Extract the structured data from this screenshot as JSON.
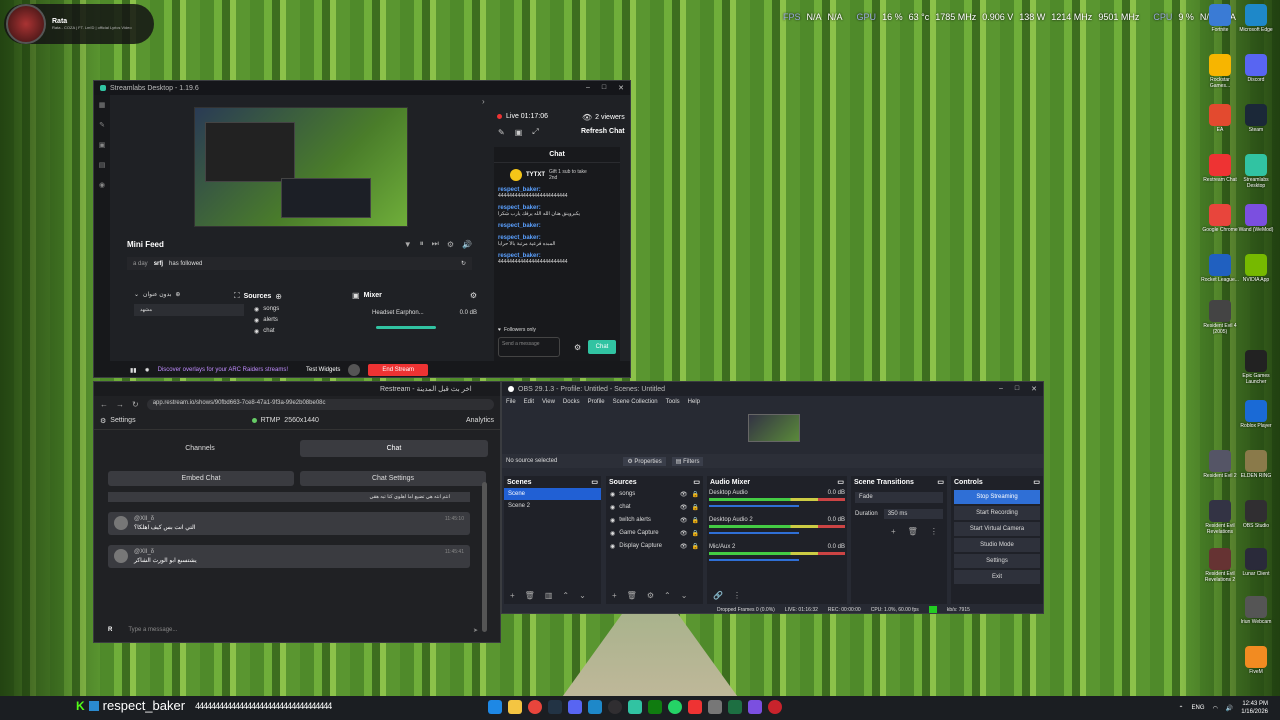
{
  "music": {
    "title": "Rata",
    "subtitle": "Rata - COZA | FT. Lm!D | official Lyrics Video"
  },
  "hud": {
    "fps_label": "FPS",
    "fps1": "N/A",
    "fps2": "N/A",
    "gpu_label": "GPU",
    "gpu_pct": "16 %",
    "gpu_temp": "63 °c",
    "gpu_clock": "1785 MHz",
    "gpu_volt": "0.906 V",
    "gpu_power": "138 W",
    "gpu_mem": "1214 MHz",
    "gpu_vram": "9501 MHz",
    "cpu_label": "CPU",
    "cpu_pct": "9 %",
    "cpu_na": "N/A",
    "cpu_na2": "N/A"
  },
  "desktop_icons": [
    {
      "label": "Fortnite",
      "color": "#3a7bd5"
    },
    {
      "label": "Microsoft Edge",
      "color": "#1e88c9"
    },
    {
      "label": "Rockstar Games...",
      "color": "#f7b500"
    },
    {
      "label": "Discord",
      "color": "#5865f2"
    },
    {
      "label": "EA",
      "color": "#e34a2f"
    },
    {
      "label": "Steam",
      "color": "#1b2838"
    },
    {
      "label": "Restream Chat",
      "color": "#e33"
    },
    {
      "label": "Streamlabs Desktop",
      "color": "#31c3a2"
    },
    {
      "label": "Google Chrome",
      "color": "#e8453c"
    },
    {
      "label": "Wand (WeMod)",
      "color": "#7b4fe0"
    },
    {
      "label": "Rocket League...",
      "color": "#2060c0"
    },
    {
      "label": "NVIDIA App",
      "color": "#76b900"
    },
    {
      "label": "Resident Evil 4 (2005)",
      "color": "#444"
    },
    {
      "label": "Epic Games Launcher",
      "color": "#222"
    },
    {
      "label": "Roblox Player",
      "color": "#1a6ad6"
    },
    {
      "label": "Resident Evil 2",
      "color": "#556"
    },
    {
      "label": "ELDEN RING",
      "color": "#8a7a4a"
    },
    {
      "label": "Resident Evil Revelations",
      "color": "#334"
    },
    {
      "label": "OBS Studio",
      "color": "#302e31"
    },
    {
      "label": "Resident Evil Revelations 2",
      "color": "#633"
    },
    {
      "label": "Lunar Client",
      "color": "#2a2a3a"
    },
    {
      "label": "Iriun Webcam",
      "color": "#555"
    },
    {
      "label": "FiveM",
      "color": "#f28b21"
    }
  ],
  "streamlabs": {
    "title": "Streamlabs Desktop - 1.19.6",
    "live": "Live 01:17:06",
    "viewers": "2 viewers",
    "refresh_chat": "Refresh Chat",
    "chat_title": "Chat",
    "gift_user": "TYTXT",
    "gift_text": "Gift 1 sub to take 2nd",
    "messages": [
      {
        "user": "respect_baker:",
        "text": "4444444444444444444444444"
      },
      {
        "user": "respect_baker:",
        "text": "يكبروينق هنان الله الله يرفك يارب شكرا"
      },
      {
        "user": "respect_baker:",
        "text": ""
      },
      {
        "user": "respect_baker:",
        "text": "المبده فرعية مرتبة بالأ حرابا"
      },
      {
        "user": "respect_baker:",
        "text": "4444444444444444444444444"
      }
    ],
    "followers_only": "Followers only",
    "send_placeholder": "Send a message",
    "chat_btn": "Chat",
    "mini_feed": "Mini Feed",
    "feed_time": "a day",
    "feed_user": "srfj",
    "feed_action": "has followed",
    "scenes_label": "بدون عنوان",
    "scene_item": "مشهد",
    "sources_label": "Sources",
    "sources": [
      "songs",
      "alerts",
      "chat"
    ],
    "mixer_label": "Mixer",
    "mixer_device": "Headset Earphon...",
    "mixer_db": "0.0 dB",
    "discover": "Discover overlays for your ARC Raiders streams!",
    "test_widgets": "Test Widgets",
    "end_stream": "End Stream"
  },
  "restream": {
    "tab_title": "Restream - اخر بث قبل المدينة",
    "url": "app.restream.io/shows/90fbd663-7ce8-47a1-9f3a-99e2b08be08c",
    "settings": "Settings",
    "rtmp": "RTMP",
    "resolution": "2560x1440",
    "analytics": "Analytics",
    "channels_tab": "Channels",
    "chat_tab": "Chat",
    "embed_chat": "Embed Chat",
    "chat_settings": "Chat Settings",
    "top_msg": "انتم انته هي تضيع اما اهلوي كنا تبه هقي",
    "messages": [
      {
        "user": "@XII_δ",
        "time": "11:45:10",
        "text": "التي انت بس كيف اهلكا؟"
      },
      {
        "user": "@XII_δ",
        "time": "11:45:41",
        "text": "يشتسبع ابو الورث الشاكر"
      }
    ],
    "type_placeholder": "Type a message..."
  },
  "obs": {
    "title": "OBS 29.1.3 - Profile: Untitled - Scenes: Untitled",
    "menu": [
      "File",
      "Edit",
      "View",
      "Docks",
      "Profile",
      "Scene Collection",
      "Tools",
      "Help"
    ],
    "no_source": "No source selected",
    "properties": "Properties",
    "filters": "Filters",
    "scenes_title": "Scenes",
    "scenes": [
      "Scene",
      "Scene 2"
    ],
    "sources_title": "Sources",
    "sources": [
      "songs",
      "chat",
      "twitch alerts",
      "Game Capture",
      "Display Capture"
    ],
    "mixer_title": "Audio Mixer",
    "mixer": [
      {
        "name": "Desktop Audio",
        "db": "0.0 dB"
      },
      {
        "name": "Desktop Audio 2",
        "db": "0.0 dB"
      },
      {
        "name": "Mic/Aux 2",
        "db": "0.0 dB"
      }
    ],
    "transitions_title": "Scene Transitions",
    "transition": "Fade",
    "duration_label": "Duration",
    "duration": "350 ms",
    "controls_title": "Controls",
    "controls": [
      "Stop Streaming",
      "Start Recording",
      "Start Virtual Camera",
      "Studio Mode",
      "Settings",
      "Exit"
    ],
    "status": {
      "dropped": "Dropped Frames 0 (0.0%)",
      "live": "LIVE: 01:16:32",
      "rec": "REC: 00:00:00",
      "cpu": "CPU: 1.0%, 60.00 fps",
      "kbps": "kb/s: 7915"
    }
  },
  "bottom_overlay": {
    "user": "respect_baker",
    "text": "4444444444444444444444444444444444"
  },
  "tray": {
    "lang": "ENG",
    "time": "12:43 PM",
    "date": "1/16/2026"
  }
}
